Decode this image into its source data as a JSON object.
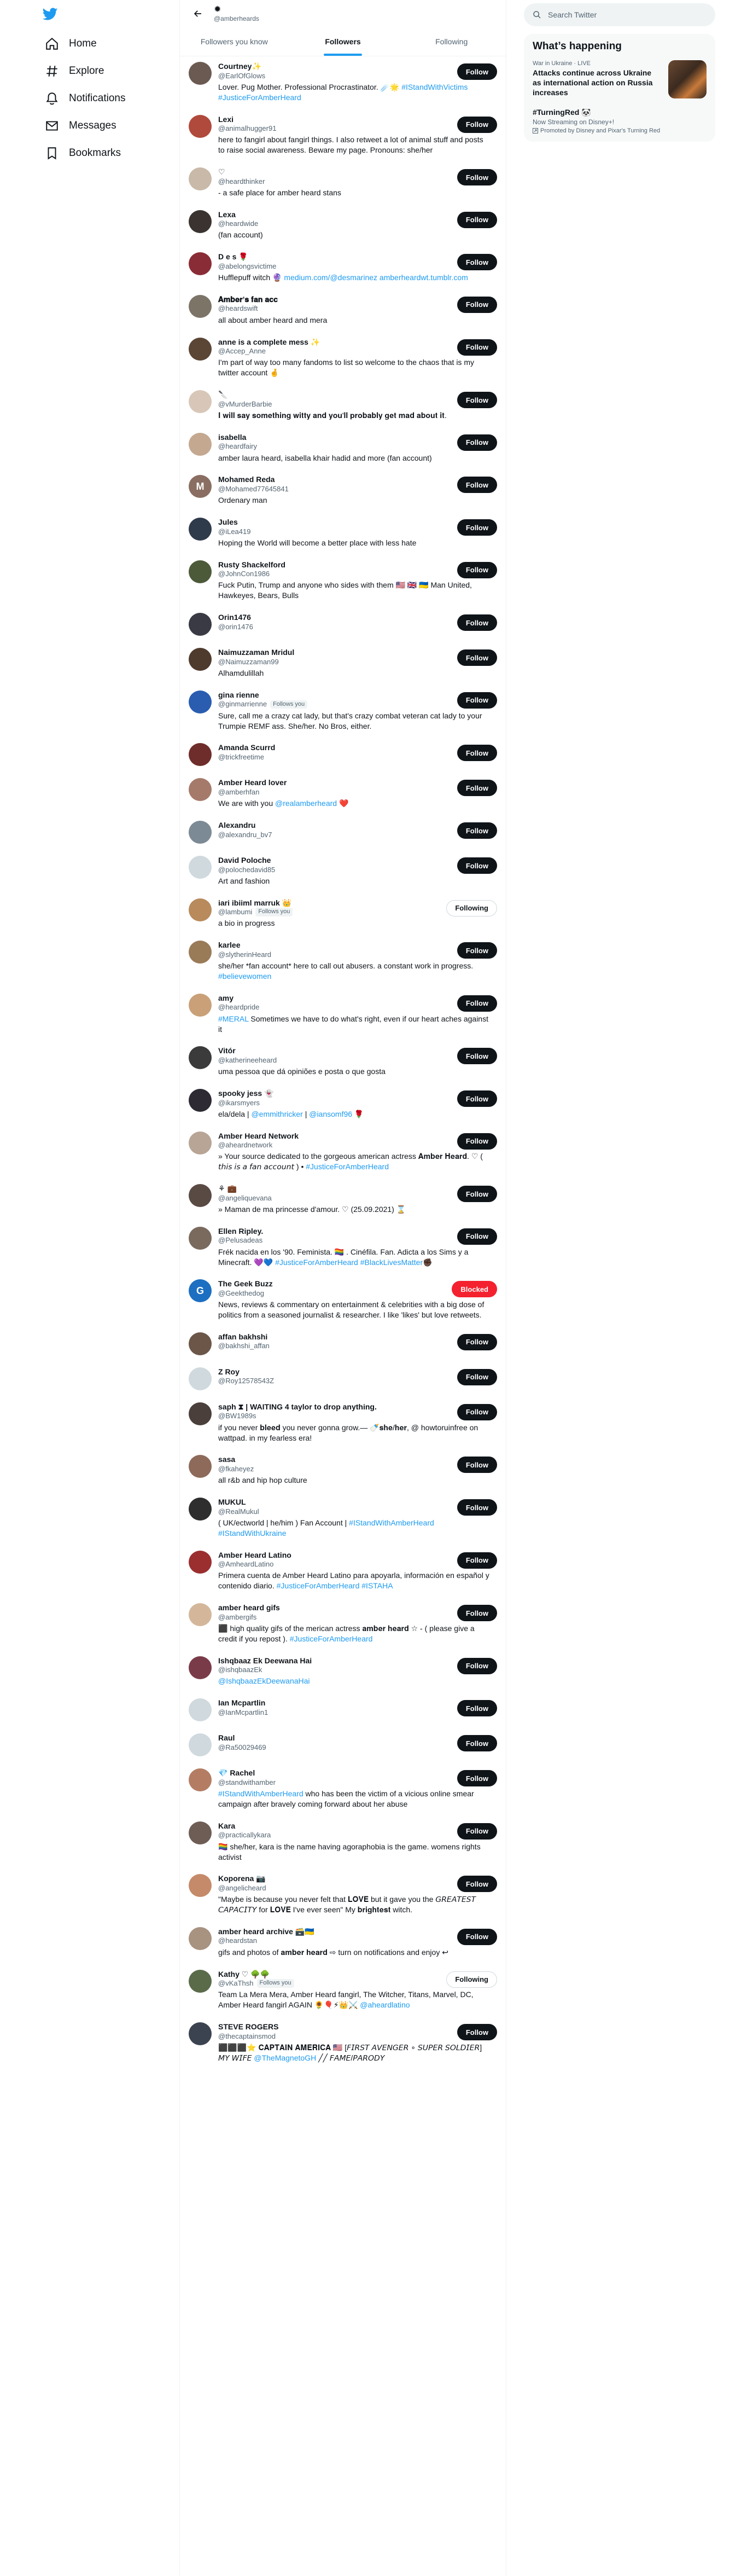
{
  "nav": {
    "items": [
      {
        "label": "Home",
        "icon": "home-icon"
      },
      {
        "label": "Explore",
        "icon": "hashtag-icon"
      },
      {
        "label": "Notifications",
        "icon": "bell-icon"
      },
      {
        "label": "Messages",
        "icon": "envelope-icon"
      },
      {
        "label": "Bookmarks",
        "icon": "bookmark-icon"
      }
    ]
  },
  "header": {
    "name": "✹",
    "handle": "@amberheards"
  },
  "tabs": [
    {
      "label": "Followers you know",
      "active": false
    },
    {
      "label": "Followers",
      "active": true
    },
    {
      "label": "Following",
      "active": false
    }
  ],
  "users": [
    {
      "name": "Courtney✨",
      "handle": "@EarlOfGlows",
      "follows_you": false,
      "bio": [
        "Lover. Pug Mother. Professional Procrastinator. ☄️🌟 ",
        {
          "l": "#IStandWithVictims"
        },
        " ",
        {
          "l": "#JusticeForAmberHeard"
        }
      ],
      "button": "Follow",
      "color": "#6b5a52"
    },
    {
      "name": "Lexi",
      "handle": "@animalhugger91",
      "follows_you": false,
      "bio": [
        "here to fangirl about fangirl things. I also retweet a lot of animal stuff and posts to raise social awareness. Beware my page. Pronouns: she/her"
      ],
      "button": "Follow",
      "color": "#b04a3c"
    },
    {
      "name": "♡",
      "handle": "@heardthinker",
      "follows_you": false,
      "bio": [
        "- a safe place for amber heard stans"
      ],
      "button": "Follow",
      "color": "#c9b9a8"
    },
    {
      "name": "Lexa",
      "handle": "@heardwide",
      "follows_you": false,
      "bio": [
        "(fan account)"
      ],
      "button": "Follow",
      "color": "#3a3330"
    },
    {
      "name": "D e s 🌹",
      "handle": "@abelongsvictime",
      "follows_you": false,
      "bio": [
        "Hufflepuff witch 🔮 ",
        {
          "l": "medium.com/@desmarinez"
        },
        " ",
        {
          "l": "amberheardwt.tumblr.com"
        }
      ],
      "button": "Follow",
      "color": "#8a2c36"
    },
    {
      "name": "𝐀𝐦𝐛𝐞𝐫’𝐬 𝐟𝐚𝐧 𝐚𝐜𝐜",
      "handle": "@heardswift",
      "follows_you": false,
      "bio": [
        "all about amber heard and mera"
      ],
      "button": "Follow",
      "color": "#7d7468"
    },
    {
      "name": "anne is a complete mess ✨",
      "handle": "@Accep_Anne",
      "follows_you": false,
      "bio": [
        "I'm part of way too many fandoms to list so welcome to the chaos that is my twitter account 🤞"
      ],
      "button": "Follow",
      "color": "#5b4636"
    },
    {
      "name": "🔪",
      "handle": "@vMurderBarbie",
      "follows_you": false,
      "bio": [
        "𝐈 𝐰𝐢𝐥𝐥 𝐬𝐚𝐲 𝐬𝐨𝐦𝐞𝐭𝐡𝐢𝐧𝐠 𝐰𝐢𝐭𝐭𝐲 𝐚𝐧𝐝 𝐲𝐨𝐮'𝐥𝐥 𝐩𝐫𝐨𝐛𝐚𝐛𝐥𝐲 𝐠𝐞𝐭 𝐦𝐚𝐝 𝐚𝐛𝐨𝐮𝐭 𝐢𝐭."
      ],
      "button": "Follow",
      "color": "#d8c7b8"
    },
    {
      "name": "isabella",
      "handle": "@heardfairy",
      "follows_you": false,
      "bio": [
        "amber laura heard, isabella khair hadid and more (fan account)"
      ],
      "button": "Follow",
      "color": "#c4a890"
    },
    {
      "name": "Mohamed Reda",
      "handle": "@Mohamed77645841",
      "follows_you": false,
      "bio": [
        "Ordenary man"
      ],
      "button": "Follow",
      "color": "#8a6e62",
      "letter": "M"
    },
    {
      "name": "Jules",
      "handle": "@iLea419",
      "follows_you": false,
      "bio": [
        "Hoping the World will become a better place with less hate"
      ],
      "button": "Follow",
      "color": "#2f3a4a"
    },
    {
      "name": "Rusty Shackelford",
      "handle": "@JohnCon1986",
      "follows_you": false,
      "bio": [
        "Fuck Putin, Trump and anyone who sides with them 🇺🇸 🇬🇧 🇺🇦 Man United, Hawkeyes, Bears, Bulls"
      ],
      "button": "Follow",
      "color": "#4d5a3a"
    },
    {
      "name": "Orin1476",
      "handle": "@orin1476",
      "follows_you": false,
      "bio": [],
      "button": "Follow",
      "color": "#3a3a44"
    },
    {
      "name": "Naimuzzaman Mridul",
      "handle": "@Naimuzzaman99",
      "follows_you": false,
      "bio": [
        "Alhamdulillah"
      ],
      "button": "Follow",
      "color": "#4e3b2e"
    },
    {
      "name": "gina rienne",
      "handle": "@ginmarrienne",
      "follows_you": true,
      "bio": [
        "Sure, call me a crazy cat lady, but that's crazy combat veteran cat lady to your Trumpie REMF ass. She/her. No Bros, either."
      ],
      "button": "Follow",
      "color": "#2a5db0"
    },
    {
      "name": "Amanda Scurrd",
      "handle": "@trickfreetime",
      "follows_you": false,
      "bio": [],
      "button": "Follow",
      "color": "#6e2d2a"
    },
    {
      "name": "Amber Heard lover",
      "handle": "@amberhfan",
      "follows_you": false,
      "bio": [
        "We are with you ",
        {
          "l": "@realamberheard"
        },
        " ❤️"
      ],
      "button": "Follow",
      "color": "#a57a6a"
    },
    {
      "name": "Alexandru",
      "handle": "@alexandru_bv7",
      "follows_you": false,
      "bio": [],
      "button": "Follow",
      "color": "#7c8a95"
    },
    {
      "name": "David Poloche",
      "handle": "@polochedavid85",
      "follows_you": false,
      "bio": [
        "Art and fashion"
      ],
      "button": "Follow",
      "color": "#cfd9de"
    },
    {
      "name": "iari ibiiml marruk 👑",
      "handle": "@lambumi",
      "follows_you": true,
      "bio": [
        "a bio in progress"
      ],
      "button": "Following",
      "color": "#b88a5c"
    },
    {
      "name": "karlee",
      "handle": "@slytherinHeard",
      "follows_you": false,
      "bio": [
        "she/her *fan account* here to call out abusers. a constant work in progress. ",
        {
          "l": "#believewomen"
        }
      ],
      "button": "Follow",
      "color": "#9a7b58"
    },
    {
      "name": "amy",
      "handle": "@heardpride",
      "follows_you": false,
      "bio": [
        {
          "l": "#MERAL"
        },
        " Sometimes we have to do what's right, even if our heart aches against it"
      ],
      "button": "Follow",
      "color": "#c9a078"
    },
    {
      "name": "Vitór",
      "handle": "@katherineeheard",
      "follows_you": false,
      "bio": [
        "uma pessoa que dá opiniões e posta o que gosta"
      ],
      "button": "Follow",
      "color": "#3b3b3b"
    },
    {
      "name": "spooky jess 👻",
      "handle": "@ikarsmyers",
      "follows_you": false,
      "bio": [
        "ela/dela | ",
        {
          "l": "@emmithricker"
        },
        " | ",
        {
          "l": "@iansomf96"
        },
        " 🌹"
      ],
      "button": "Follow",
      "color": "#2d2a33"
    },
    {
      "name": "Amber Heard Network",
      "handle": "@aheardnetwork",
      "follows_you": false,
      "bio": [
        "» Your source dedicated to the gorgeous american actress 𝐀𝐦𝐛𝐞𝐫 𝐇𝐞𝐚𝐫𝐝. ♡ ( 𝘵𝘩𝘪𝘴 𝘪𝘴 𝘢 𝘧𝘢𝘯 𝘢𝘤𝘤𝘰𝘶𝘯𝘵 ) • ",
        {
          "l": "#JusticeForAmberHeard"
        }
      ],
      "button": "Follow",
      "color": "#b8a596"
    },
    {
      "name": "⚘ 💼",
      "handle": "@angeliquevana",
      "follows_you": false,
      "bio": [
        "» Maman de ma princesse d'amour. ♡ (25.09.2021) ⌛"
      ],
      "button": "Follow",
      "color": "#5a4a44"
    },
    {
      "name": "Ellen Ripley.",
      "handle": "@Pelusadeas",
      "follows_you": false,
      "bio": [
        "Frék nacida en los '90. Feminista. 🏳️‍🌈 . Cinéfila. Fan. Adicta a los Sims y a Minecraft. 💜💙 ",
        {
          "l": "#JusticeForAmberHeard"
        },
        " ",
        {
          "l": "#BlackLivesMatter"
        },
        "✊🏿"
      ],
      "button": "Follow",
      "color": "#7a6a5e"
    },
    {
      "name": "The Geek Buzz",
      "handle": "@Geekthedog",
      "follows_you": false,
      "bio": [
        "News, reviews & commentary on entertainment & celebrities with a big dose of politics from a seasoned journalist & researcher. I like 'likes' but love retweets."
      ],
      "button": "Blocked",
      "color": "#1d6fc1",
      "letter": "G"
    },
    {
      "name": "affan bakhshi",
      "handle": "@bakhshi_affan",
      "follows_you": false,
      "bio": [],
      "button": "Follow",
      "color": "#6b5648"
    },
    {
      "name": "Z Roy",
      "handle": "@Roy12578543Z",
      "follows_you": false,
      "bio": [],
      "button": "Follow",
      "color": "#cfd9de"
    },
    {
      "name": "saph ⧗ | WAITING 4 taylor to drop anything.",
      "handle": "@BW1989s",
      "follows_you": false,
      "bio": [
        "if you never 𝐛𝐥𝐞𝐞𝐝 you never gonna grow.— 🍼𝐬𝐡𝐞/𝐡𝐞𝐫, @ howtoruinfree on wattpad. in my fearless era!"
      ],
      "button": "Follow",
      "color": "#4a3f3a"
    },
    {
      "name": "sasa",
      "handle": "@fkaheyez",
      "follows_you": false,
      "bio": [
        "all r&b and hip hop culture"
      ],
      "button": "Follow",
      "color": "#8d6a5a"
    },
    {
      "name": "MUKUL",
      "handle": "@RealMukul",
      "follows_you": false,
      "bio": [
        "( UK/ectworld | he/him ) Fan Account | ",
        {
          "l": "#IStandWithAmberHeard"
        },
        " ",
        {
          "l": "#IStandWithUkraine"
        }
      ],
      "button": "Follow",
      "color": "#2e2e2e"
    },
    {
      "name": "Amber Heard Latino",
      "handle": "@AmheardLatino",
      "follows_you": false,
      "bio": [
        "Primera cuenta de Amber Heard Latino para apoyarla, información en español y contenido diario. ",
        {
          "l": "#JusticeForAmberHeard"
        },
        " ",
        {
          "l": "#ISTAHA"
        }
      ],
      "button": "Follow",
      "color": "#9b2f2f"
    },
    {
      "name": "amber heard gifs",
      "handle": "@ambergifs",
      "follows_you": false,
      "bio": [
        "⬛ high quality gifs of the merican actress 𝐚𝐦𝐛𝐞𝐫 𝐡𝐞𝐚𝐫𝐝 ☆ - ( please give a credit if you repost ). ",
        {
          "l": "#JusticeForAmberHeard"
        }
      ],
      "button": "Follow",
      "color": "#d4b79a"
    },
    {
      "name": "Ishqbaaz Ek Deewana Hai",
      "handle": "@ishqbaazEk",
      "follows_you": false,
      "bio": [
        {
          "l": "@IshqbaazEkDeewanaHai"
        }
      ],
      "button": "Follow",
      "color": "#7a3b48"
    },
    {
      "name": "Ian Mcpartlin",
      "handle": "@IanMcpartlin1",
      "follows_you": false,
      "bio": [],
      "button": "Follow",
      "color": "#cfd9de"
    },
    {
      "name": "Raul",
      "handle": "@Ra50029469",
      "follows_you": false,
      "bio": [],
      "button": "Follow",
      "color": "#cfd9de"
    },
    {
      "name": "💎 Rachel",
      "handle": "@standwithamber",
      "follows_you": false,
      "bio": [
        {
          "l": "#IStandWithAmberHeard"
        },
        " who has been the victim of a vicious online smear campaign after bravely coming forward about her abuse"
      ],
      "button": "Follow",
      "color": "#b47d63"
    },
    {
      "name": "Kara",
      "handle": "@practicallykara",
      "follows_you": false,
      "bio": [
        "🏳️‍🌈 she/her, kara is the name having agoraphobia is the game. womens rights activist"
      ],
      "button": "Follow",
      "color": "#6e5d55"
    },
    {
      "name": "Koporena 📷",
      "handle": "@angelicheard",
      "follows_you": false,
      "bio": [
        "\"Maybe is because you never felt that 𝐋𝐎𝐕𝐄 but it gave you the 𝘎𝘙𝘌𝘈𝘛𝘌𝘚𝘛 𝘊𝘈𝘗𝘈𝘊𝘐𝘛𝘠 for 𝐋𝐎𝐕𝐄 I've ever seen\" My 𝐛𝐫𝐢𝐠𝐡𝐭𝐞𝐬𝐭 witch."
      ],
      "button": "Follow",
      "color": "#c58a6a"
    },
    {
      "name": "amber heard archive 🗃️🇺🇦",
      "handle": "@heardstan",
      "follows_you": false,
      "bio": [
        "gifs and photos of 𝐚𝐦𝐛𝐞𝐫 𝐡𝐞𝐚𝐫𝐝 ⇨ turn on notifications and enjoy ↩"
      ],
      "button": "Follow",
      "color": "#a89280"
    },
    {
      "name": "Kathy ♡ 🌳🌳",
      "handle": "@vKaThsh",
      "follows_you": true,
      "bio": [
        "Team La Mera Mera, Amber Heard fangirl, The Witcher, Titans, Marvel, DC, Amber Heard fangirl AGAIN 🌻🎈⚡👑⚔️ ",
        {
          "l": "@aheardlatino"
        }
      ],
      "button": "Following",
      "color": "#5a6b4a"
    },
    {
      "name": "STEVE ROGERS",
      "handle": "@thecaptainsmod",
      "follows_you": false,
      "bio": [
        "⬛⬛⬛⭐ 𝐂𝐀𝐏𝐓𝐀𝐈𝐍 𝐀𝐌𝐄𝐑𝐈𝐂𝐀 🇺🇸 [𝘍𝘐𝘙𝘚𝘛 𝘈𝘝𝘌𝘕𝘎𝘌𝘙 ∘ 𝘚𝘜𝘗𝘌𝘙 𝘚𝘖𝘓𝘋𝘐𝘌𝘙] 𝘔𝘠 𝘞𝘐𝘍𝘌 ",
        {
          "l": "@TheMagnetoGH"
        },
        " ╱╱ 𝘍𝘈𝘔𝘌/𝘗𝘈𝘙𝘖𝘋𝘠"
      ],
      "button": "Follow",
      "color": "#3c4350"
    }
  ],
  "labels": {
    "follows_you": "Follows you"
  },
  "search": {
    "placeholder": "Search Twitter"
  },
  "trends": {
    "title": "What’s happening",
    "items": [
      {
        "meta": "War in Ukraine · LIVE",
        "headline": "Attacks continue across Ukraine as international action on Russia increases",
        "thumb": "ukraine-news-image"
      },
      {
        "meta": "",
        "headline": "#TurningRed 🐼",
        "sub": "Now Streaming on Disney+!",
        "promo": "Promoted by Disney and Pixar's Turning Red"
      }
    ]
  },
  "colors": {
    "accent": "#1d9bf0",
    "follow_bg": "#0f1419",
    "blocked_bg": "#f4212e"
  }
}
